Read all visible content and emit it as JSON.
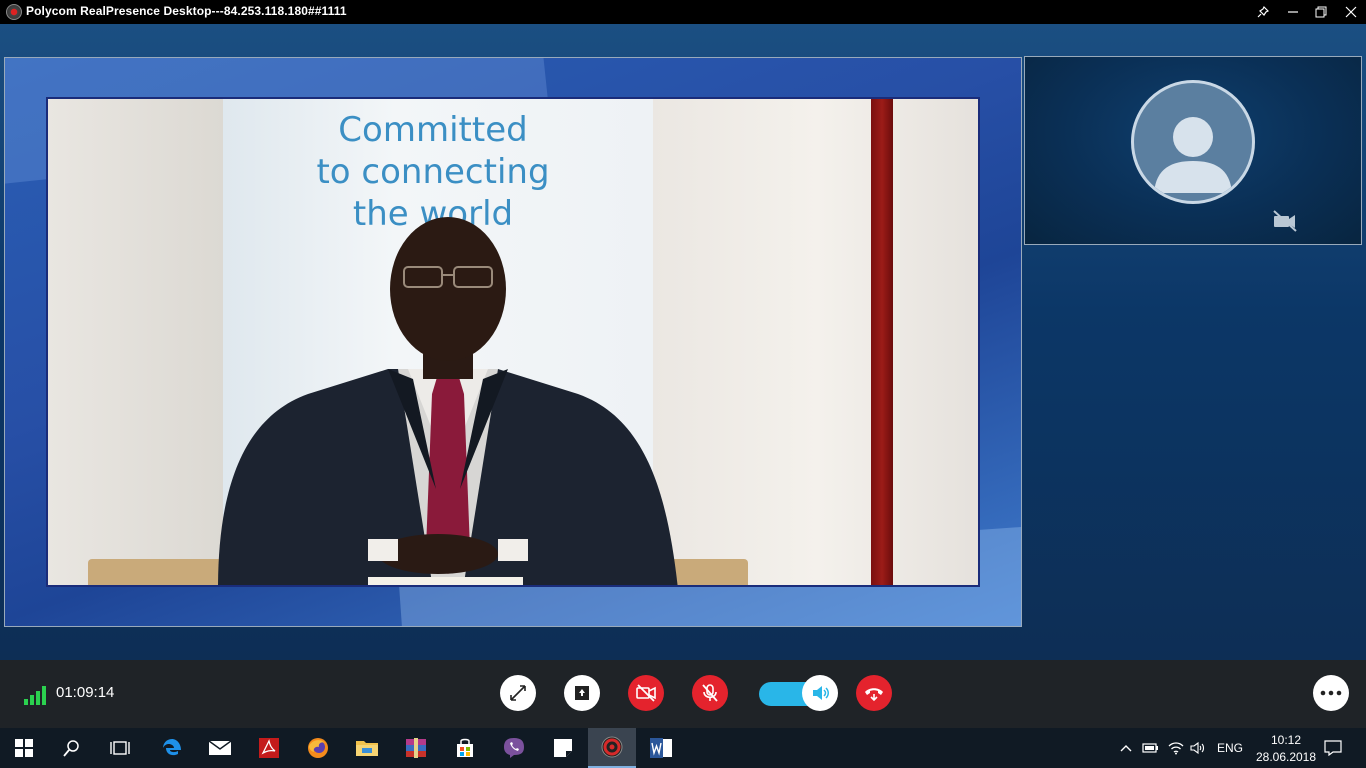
{
  "window": {
    "title": "Polycom RealPresence Desktop---84.253.118.180##1111",
    "buttons": [
      "pin-icon",
      "minimize-icon",
      "restore-icon",
      "close-icon"
    ]
  },
  "video": {
    "banner_lines": [
      "Committed",
      "to connecting",
      "the world"
    ]
  },
  "controls": {
    "call_timer": "01:09:14",
    "signal_level": 4,
    "volume_level": 0.7,
    "buttons": [
      "fullscreen",
      "content-share",
      "camera-off",
      "mic-muted",
      "volume",
      "hang-up",
      "more"
    ],
    "accent_colors": {
      "danger": "#e4232d",
      "volume": "#29b6e8"
    }
  },
  "taskbar": {
    "apps": [
      "start",
      "search",
      "task-view",
      "edge",
      "mail",
      "acrobat",
      "firefox",
      "file-explorer",
      "winrar",
      "store",
      "viber",
      "sticky-notes",
      "polycom",
      "word"
    ],
    "tray": {
      "language": "ENG",
      "time": "10:12",
      "date": "28.06.2018"
    }
  }
}
